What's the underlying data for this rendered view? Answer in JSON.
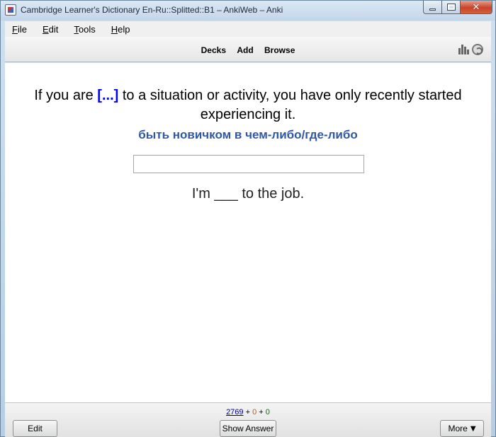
{
  "window": {
    "title": "Cambridge Learner's Dictionary En-Ru::Splitted::B1 – AnkiWeb – Anki"
  },
  "menubar": {
    "items": [
      {
        "label": "ile",
        "mnemonic": "F"
      },
      {
        "label": "dit",
        "mnemonic": "E"
      },
      {
        "label": "ools",
        "mnemonic": "T"
      },
      {
        "label": "elp",
        "mnemonic": "H"
      }
    ]
  },
  "toolbar": {
    "decks": "Decks",
    "add": "Add",
    "browse": "Browse",
    "icons": [
      "stats-icon",
      "sync-icon"
    ]
  },
  "card": {
    "question_before": "If you are ",
    "cloze": "[...]",
    "question_after": " to a situation or activity, you have only recently started experiencing it.",
    "translation": "быть новичком в чем-либо/где-либо",
    "answer_value": "",
    "example": "I'm ___ to the job."
  },
  "bottom": {
    "count_new": "2769",
    "plus1": "+",
    "count_learn": "0",
    "plus2": "+",
    "count_review": "0",
    "edit_label": "Edit",
    "show_answer_label": "Show Answer",
    "more_label": "More",
    "more_arrow": "▼"
  },
  "colors": {
    "cloze": "#0000ff",
    "translation": "#2e57a8",
    "count_new": "#00008b",
    "count_learn": "#c35617",
    "count_review": "#007700"
  }
}
